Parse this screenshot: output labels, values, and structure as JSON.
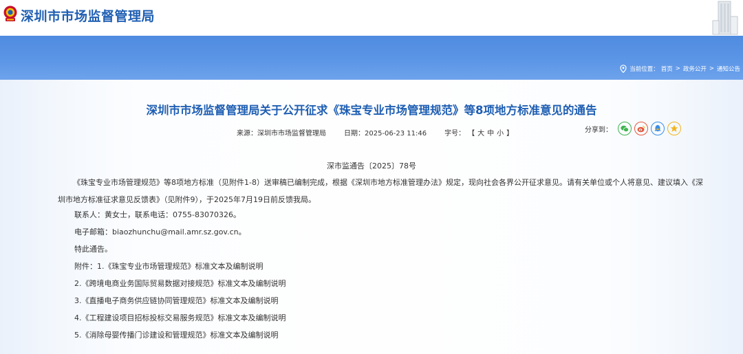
{
  "header": {
    "site_title": "深圳市市场监督管理局"
  },
  "breadcrumb": {
    "prefix": "当前位置：",
    "items": [
      "首页",
      "政务公开",
      "通知公告"
    ],
    "separator": ">"
  },
  "article": {
    "title": "深圳市市场监督管理局关于公开征求《珠宝专业市场管理规范》等8项地方标准意见的通告",
    "source_label": "来源：",
    "source": "深圳市市场监督管理局",
    "date_label": "日期：",
    "date": "2025-06-23 11:46",
    "fontsize_label": "字号：",
    "fontsize_open": "【",
    "fontsize_options": [
      "大",
      "中",
      "小"
    ],
    "fontsize_close": "】",
    "share_label": "分享到：",
    "share_icons": [
      "wechat-icon",
      "weibo-icon",
      "qq-icon",
      "qzone-icon"
    ],
    "doc_number": "深市监通告〔2025〕78号",
    "para1": "《珠宝专业市场管理规范》等8项地方标准（见附件1-8）送审稿已编制完成，根据《深圳市地方标准管理办法》规定，现向社会各界公开征求意见。请有关单位或个人将意见、建议填入《深圳市地方标准征求意见反馈表》（见附件9），于2025年7月19日前反馈我局。",
    "contact": "联系人：黄女士，联系电话：0755-83070326。",
    "email": "电子邮箱：biaozhunchu@mail.amr.sz.gov.cn。",
    "notice": "特此通告。",
    "attachments": [
      "附件：1.《珠宝专业市场管理规范》标准文本及编制说明",
      "2.《跨境电商业务国际贸易数据对接规范》标准文本及编制说明",
      "3.《直播电子商务供应链协同管理规范》标准文本及编制说明",
      "4.《工程建设项目招标投标交易服务规范》标准文本及编制说明",
      "5.《消除母婴传播门诊建设和管理规范》标准文本及编制说明"
    ]
  },
  "colors": {
    "title_blue": "#1f5fb3",
    "banner_blue": "#5b95e6",
    "wechat": "#3fb34f",
    "weibo": "#e8563b",
    "qq": "#3a8ee6",
    "qzone": "#f2b51c"
  }
}
